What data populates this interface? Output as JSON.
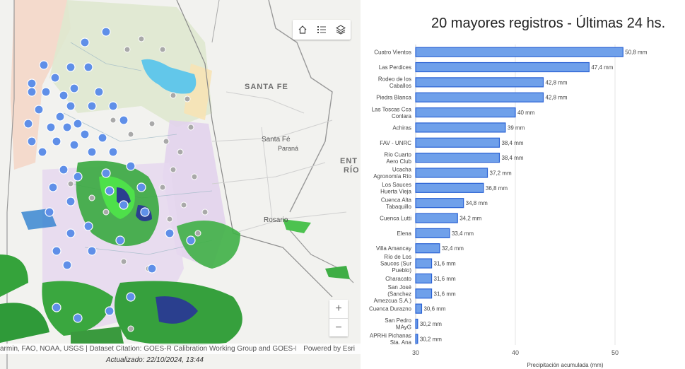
{
  "map": {
    "labels": {
      "santa_fe_region": "SANTA FE",
      "entre_rios_1": "ENT",
      "entre_rios_2": "RÍO",
      "santa_fe_city": "Santa Fé",
      "parana": "Paraná",
      "rosario": "Rosario"
    },
    "toolbar": {
      "home_icon": "home-icon",
      "legend_icon": "legend-list-icon",
      "layers_icon": "layers-icon"
    },
    "zoom": {
      "in_label": "+",
      "out_label": "−"
    },
    "attribution": "armin, FAO, NOAA, USGS | Dataset Citation: GOES-R Calibration Working Group and GOES-R ...",
    "powered_by": "Powered by Esri",
    "updated": "Actualizado: 22/10/2024, 13:44"
  },
  "chart_data": {
    "type": "bar",
    "orientation": "horizontal",
    "title": "20 mayores registros - Últimas 24 hs.",
    "xlabel": "Precipitación acumulada (mm)",
    "xlim": [
      30,
      51
    ],
    "xticks": [
      30,
      40,
      50
    ],
    "bar_color": "#6fa0ea",
    "bar_border": "#2a62d4",
    "categories": [
      [
        "Cuatro Vientos"
      ],
      [
        "Las Perdices"
      ],
      [
        "Rodeo de los",
        "Caballos"
      ],
      [
        "Piedra Blanca"
      ],
      [
        "Las Toscas Cca",
        "Conlara"
      ],
      [
        "Achiras"
      ],
      [
        "FAV - UNRC"
      ],
      [
        "Río Cuarto",
        "Aero Club"
      ],
      [
        "Ucacha",
        "Agronomía Río"
      ],
      [
        "Los Sauces",
        "Huerta Vieja"
      ],
      [
        "Cuenca Alta",
        "Tabaquillo"
      ],
      [
        "Cuenca Lutti"
      ],
      [
        "Elena"
      ],
      [
        "Villa Amancay"
      ],
      [
        "Río de Los",
        "Sauces (Sur",
        "Pueblo)"
      ],
      [
        "Characato"
      ],
      [
        "San José",
        "(Sanchez",
        "Amezcua S.A.)"
      ],
      [
        "Cuenca Durazno"
      ],
      [
        "San Pedro",
        "MAyG"
      ],
      [
        "APRHi Pichanas",
        "Sta. Ana"
      ]
    ],
    "values": [
      50.8,
      47.4,
      42.8,
      42.8,
      40,
      39,
      38.4,
      38.4,
      37.2,
      36.8,
      34.8,
      34.2,
      33.4,
      32.4,
      31.6,
      31.6,
      31.6,
      30.6,
      30.2,
      30.2
    ],
    "value_labels": [
      "50,8 mm",
      "47,4 mm",
      "42,8 mm",
      "42,8 mm",
      "40 mm",
      "39 mm",
      "38,4 mm",
      "38,4 mm",
      "37,2 mm",
      "36,8 mm",
      "34,8 mm",
      "34,2 mm",
      "33,4 mm",
      "32,4 mm",
      "31,6 mm",
      "31,6 mm",
      "31,6 mm",
      "30,6 mm",
      "30,2 mm",
      "30,2 mm"
    ]
  }
}
